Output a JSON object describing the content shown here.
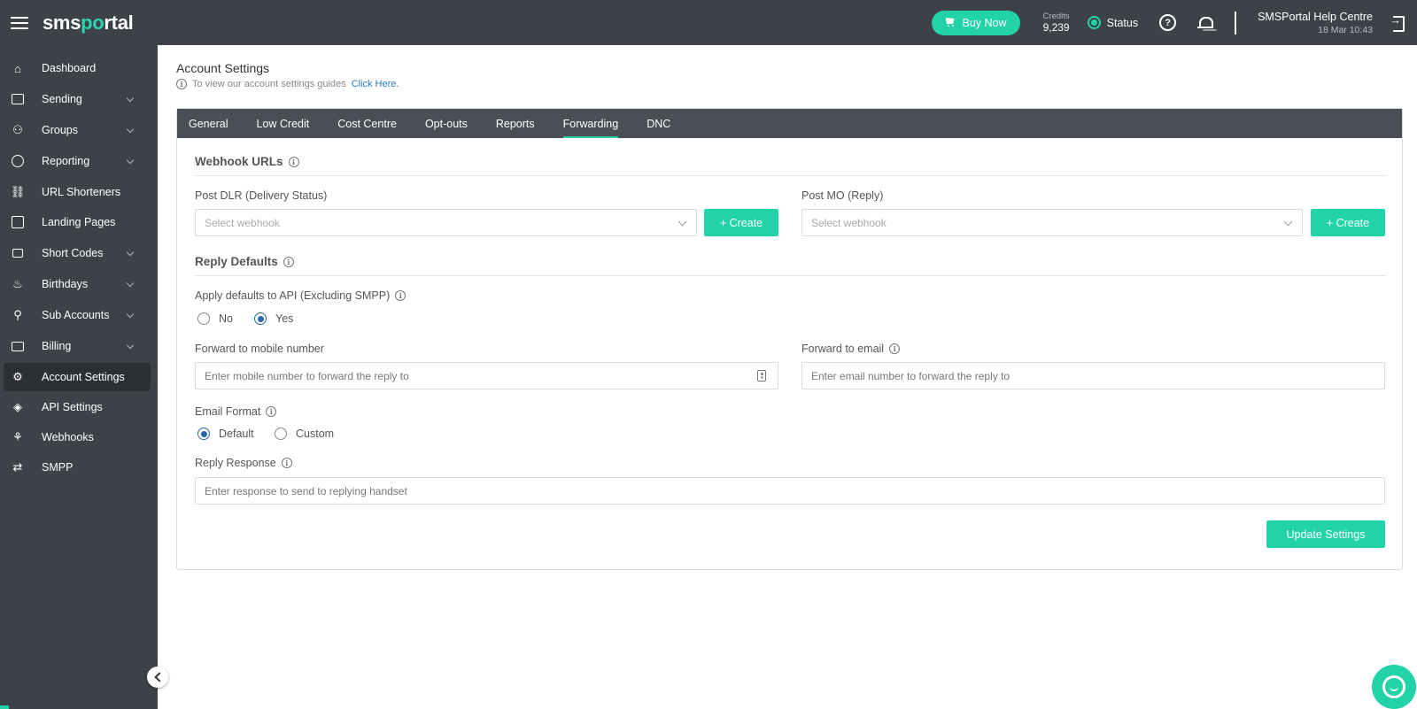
{
  "header": {
    "logo_text_before": "sms",
    "logo_text_o": "p",
    "logo_text_after": "rtal",
    "buy_label": "Buy Now",
    "credits_label": "Credits",
    "credits_value": "9,239",
    "status_label": "Status",
    "user_name": "SMSPortal Help Centre",
    "datetime": "18 Mar 10:43"
  },
  "sidebar": {
    "items": [
      {
        "label": "Dashboard",
        "icon": "home-icon"
      },
      {
        "label": "Sending",
        "icon": "mail-icon"
      },
      {
        "label": "Groups",
        "icon": "users-icon"
      },
      {
        "label": "Reporting",
        "icon": "pie-chart-icon"
      },
      {
        "label": "URL Shorteners",
        "icon": "link-icon"
      },
      {
        "label": "Landing Pages",
        "icon": "landing-page-icon"
      },
      {
        "label": "Short Codes",
        "icon": "short-codes-icon"
      },
      {
        "label": "Birthdays",
        "icon": "cake-icon"
      },
      {
        "label": "Sub Accounts",
        "icon": "add-user-icon"
      },
      {
        "label": "Billing",
        "icon": "credit-card-icon"
      },
      {
        "label": "Account Settings",
        "icon": "gear-icon"
      },
      {
        "label": "API Settings",
        "icon": "layers-icon"
      },
      {
        "label": "Webhooks",
        "icon": "webhook-icon"
      },
      {
        "label": "SMPP",
        "icon": "repeat-icon"
      }
    ]
  },
  "page": {
    "title": "Account Settings",
    "guide_text": "To view our account settings guides",
    "guide_link": "Click Here."
  },
  "tabs": [
    "General",
    "Low Credit",
    "Cost Centre",
    "Opt-outs",
    "Reports",
    "Forwarding",
    "DNC"
  ],
  "webhooks": {
    "title": "Webhook URLs",
    "dlr_label": "Post DLR (Delivery Status)",
    "dlr_placeholder": "Select webhook",
    "mo_label": "Post MO (Reply)",
    "mo_placeholder": "Select webhook",
    "create_label": "+ Create"
  },
  "reply": {
    "title": "Reply Defaults",
    "api_label": "Apply defaults to API (Excluding SMPP)",
    "no_label": "No",
    "yes_label": "Yes",
    "mobile_label": "Forward to mobile number",
    "mobile_placeholder": "Enter mobile number to forward the reply to",
    "email_label": "Forward to email",
    "email_placeholder": "Enter email number to forward the reply to",
    "format_label": "Email Format",
    "default_label": "Default",
    "custom_label": "Custom",
    "response_label": "Reply Response",
    "response_placeholder": "Enter response to send to replying handset",
    "update_label": "Update Settings"
  },
  "colors": {
    "accent": "#22d3a8",
    "nav_bg": "#3d4148",
    "tab_bg": "#4a4e55",
    "radio_checked": "#2a66a8"
  }
}
